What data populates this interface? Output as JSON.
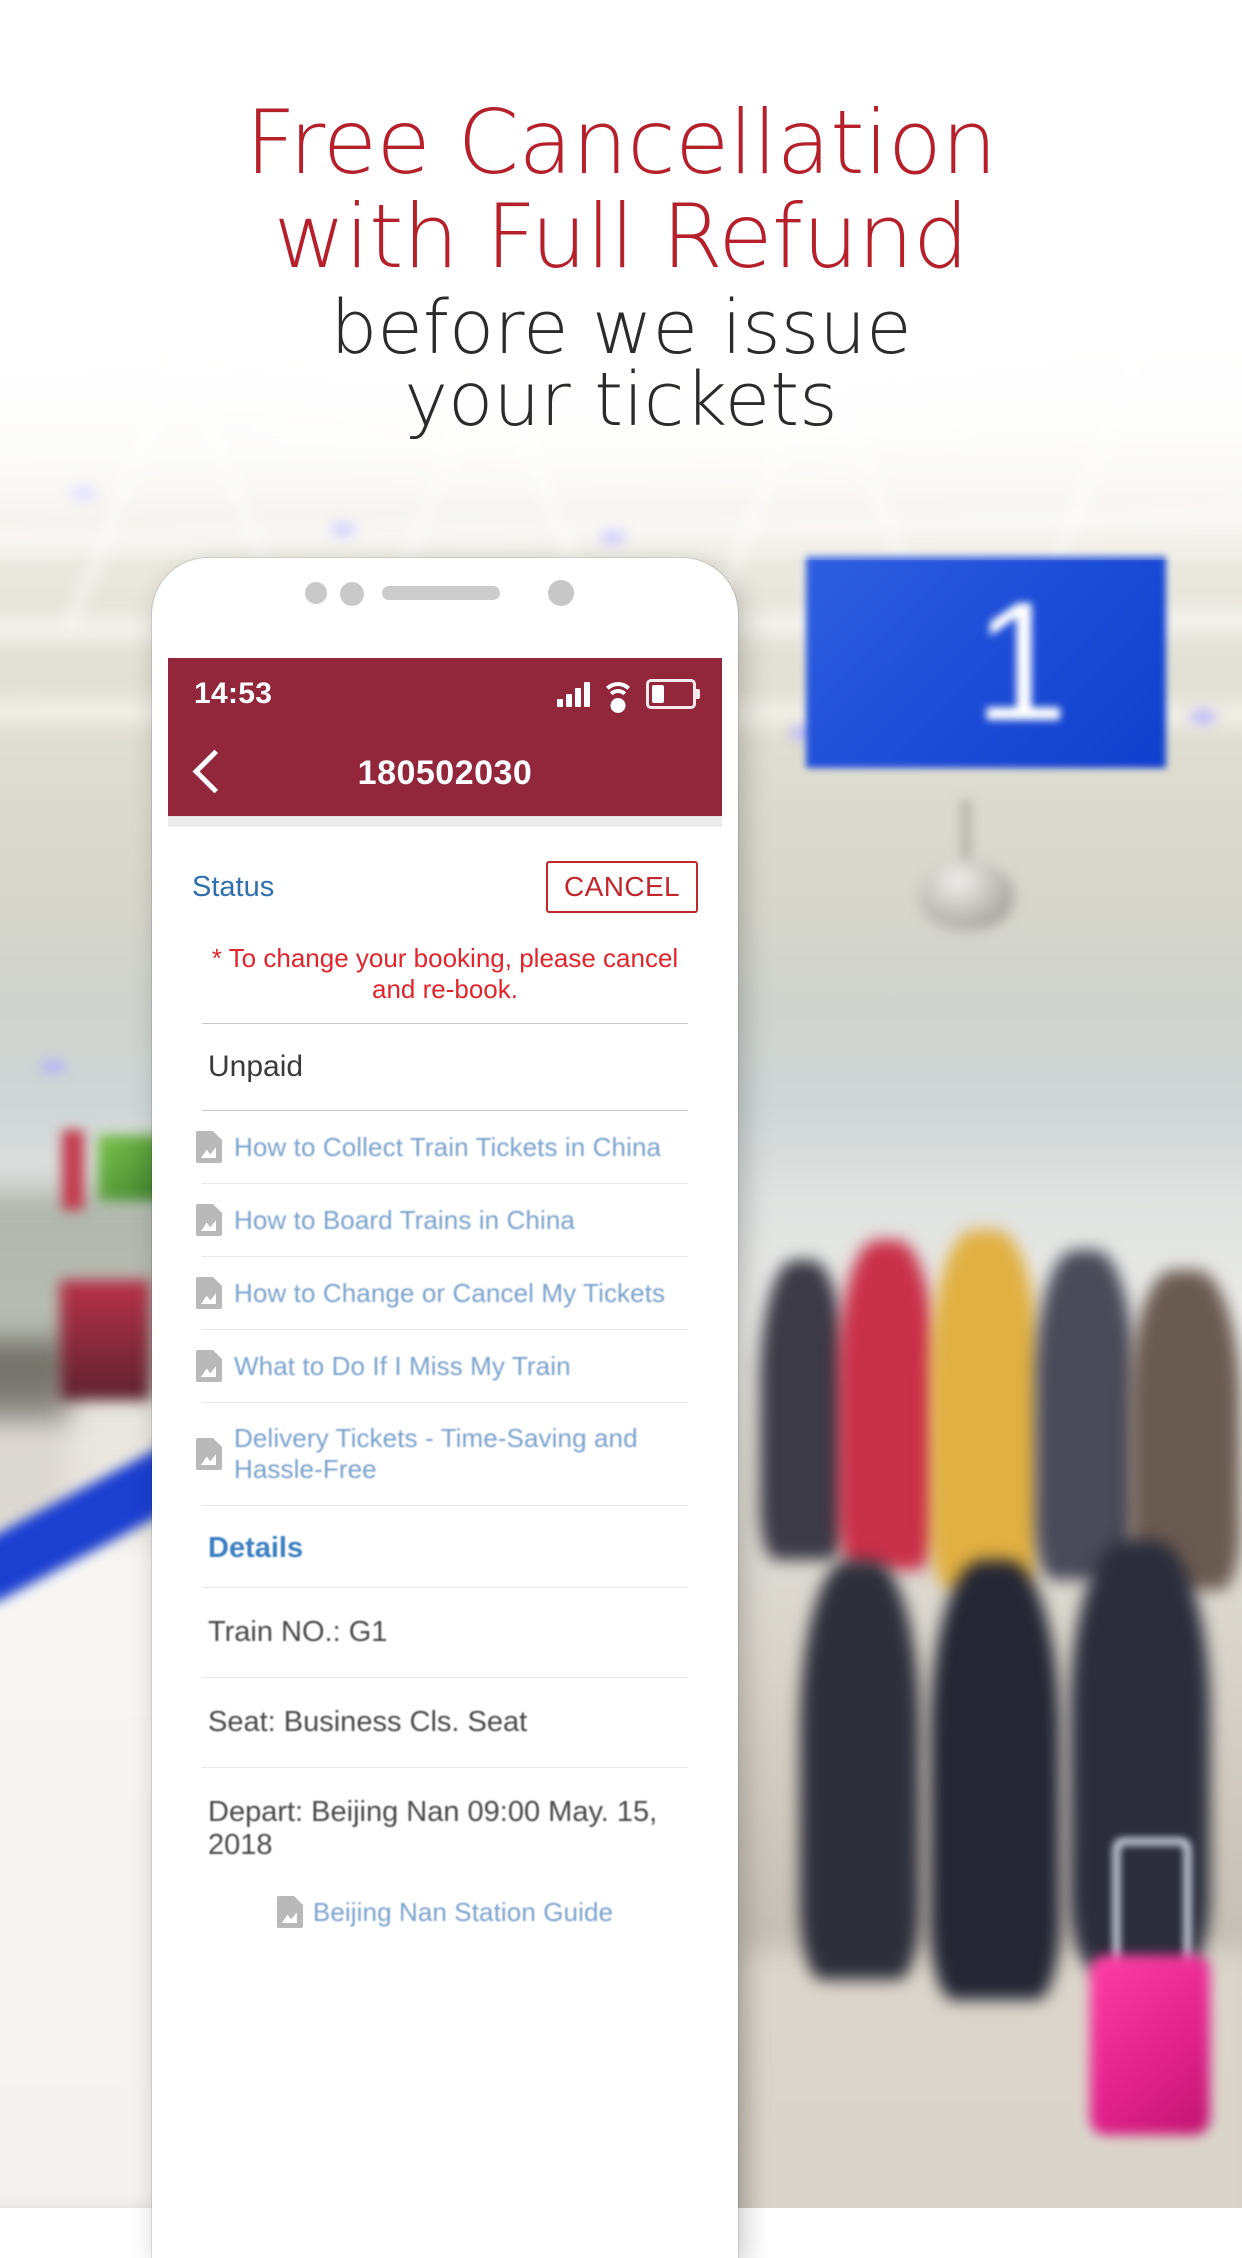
{
  "promo": {
    "headline_line1": "Free Cancellation",
    "headline_line2": "with Full Refund",
    "subhead_line1": "before we issue",
    "subhead_line2": "your tickets",
    "headline_color": "#b5202a",
    "subhead_color": "#2b2b2b"
  },
  "background": {
    "platform_sign_number": "1",
    "brand_red": "#92263a"
  },
  "phone": {
    "statusbar": {
      "time": "14:53",
      "signal_icon": "signal-bars-icon",
      "wifi_icon": "wifi-icon",
      "battery_icon": "battery-low-icon"
    },
    "navbar": {
      "back_icon": "back-chevron-icon",
      "title": "180502030"
    },
    "booking": {
      "status_label": "Status",
      "cancel_label": "CANCEL",
      "cancel_note": "* To change your booking, please cancel and re-book.",
      "status_value": "Unpaid"
    },
    "documents": [
      {
        "icon": "pdf-icon",
        "label": "How to Collect Train Tickets in China"
      },
      {
        "icon": "pdf-icon",
        "label": "How to Board Trains in China"
      },
      {
        "icon": "pdf-icon",
        "label": "How to Change or Cancel My Tickets"
      },
      {
        "icon": "pdf-icon",
        "label": "What to Do If I Miss My Train"
      },
      {
        "icon": "pdf-icon",
        "label": "Delivery Tickets - Time-Saving and Hassle-Free"
      }
    ],
    "details": {
      "heading": "Details",
      "rows": [
        "Train NO.: G1",
        "Seat: Business Cls. Seat",
        "Depart: Beijing Nan 09:00 May. 15, 2018"
      ],
      "station_guide": {
        "icon": "pdf-icon",
        "label": "Beijing Nan Station Guide"
      }
    }
  }
}
